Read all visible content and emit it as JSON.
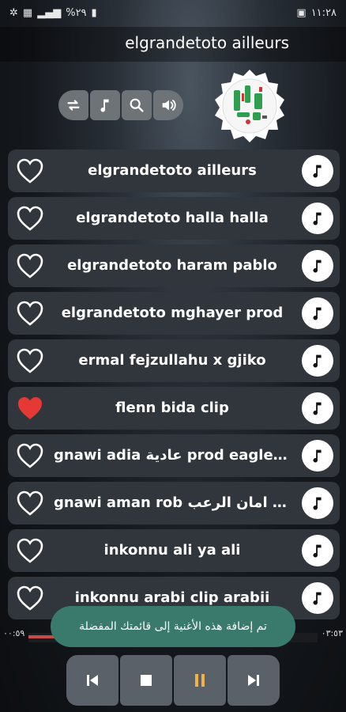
{
  "status": {
    "time": "١١:٢٨",
    "battery": "%٢٩"
  },
  "header": {
    "title": "elgrandetoto ailleurs"
  },
  "controls": [
    {
      "icon": "repeat-icon"
    },
    {
      "icon": "music-note-icon"
    },
    {
      "icon": "search-icon"
    },
    {
      "icon": "volume-icon"
    }
  ],
  "songs": [
    {
      "title": "elgrandetoto ailleurs",
      "favorite": false
    },
    {
      "title": "elgrandetoto halla halla",
      "favorite": false
    },
    {
      "title": "elgrandetoto haram pablo",
      "favorite": false
    },
    {
      "title": "elgrandetoto mghayer prod",
      "favorite": false
    },
    {
      "title": "ermal fejzullahu x gjiko",
      "favorite": false
    },
    {
      "title": "flenn bida clip",
      "favorite": true
    },
    {
      "title": "gnawi adia عادية prod eagle e...",
      "favorite": false
    },
    {
      "title": "gnawi aman rob امان الرعب pr...",
      "favorite": false
    },
    {
      "title": "inkonnu ali ya ali",
      "favorite": false
    },
    {
      "title": "inkonnu arabi clip arabii",
      "favorite": false
    }
  ],
  "progress": {
    "elapsed": "٠٠:٥٩",
    "total": "٠٣:٥٣",
    "fraction": 0.26
  },
  "toast": {
    "message": "تم إضافة هذه الأغنية إلى قائمتك المفضلة"
  },
  "player": [
    {
      "icon": "previous-icon"
    },
    {
      "icon": "stop-icon"
    },
    {
      "icon": "pause-icon"
    },
    {
      "icon": "next-icon"
    }
  ],
  "colors": {
    "heart_active": "#e53935",
    "toast": "#3a7a6d",
    "row": "#31353c"
  }
}
